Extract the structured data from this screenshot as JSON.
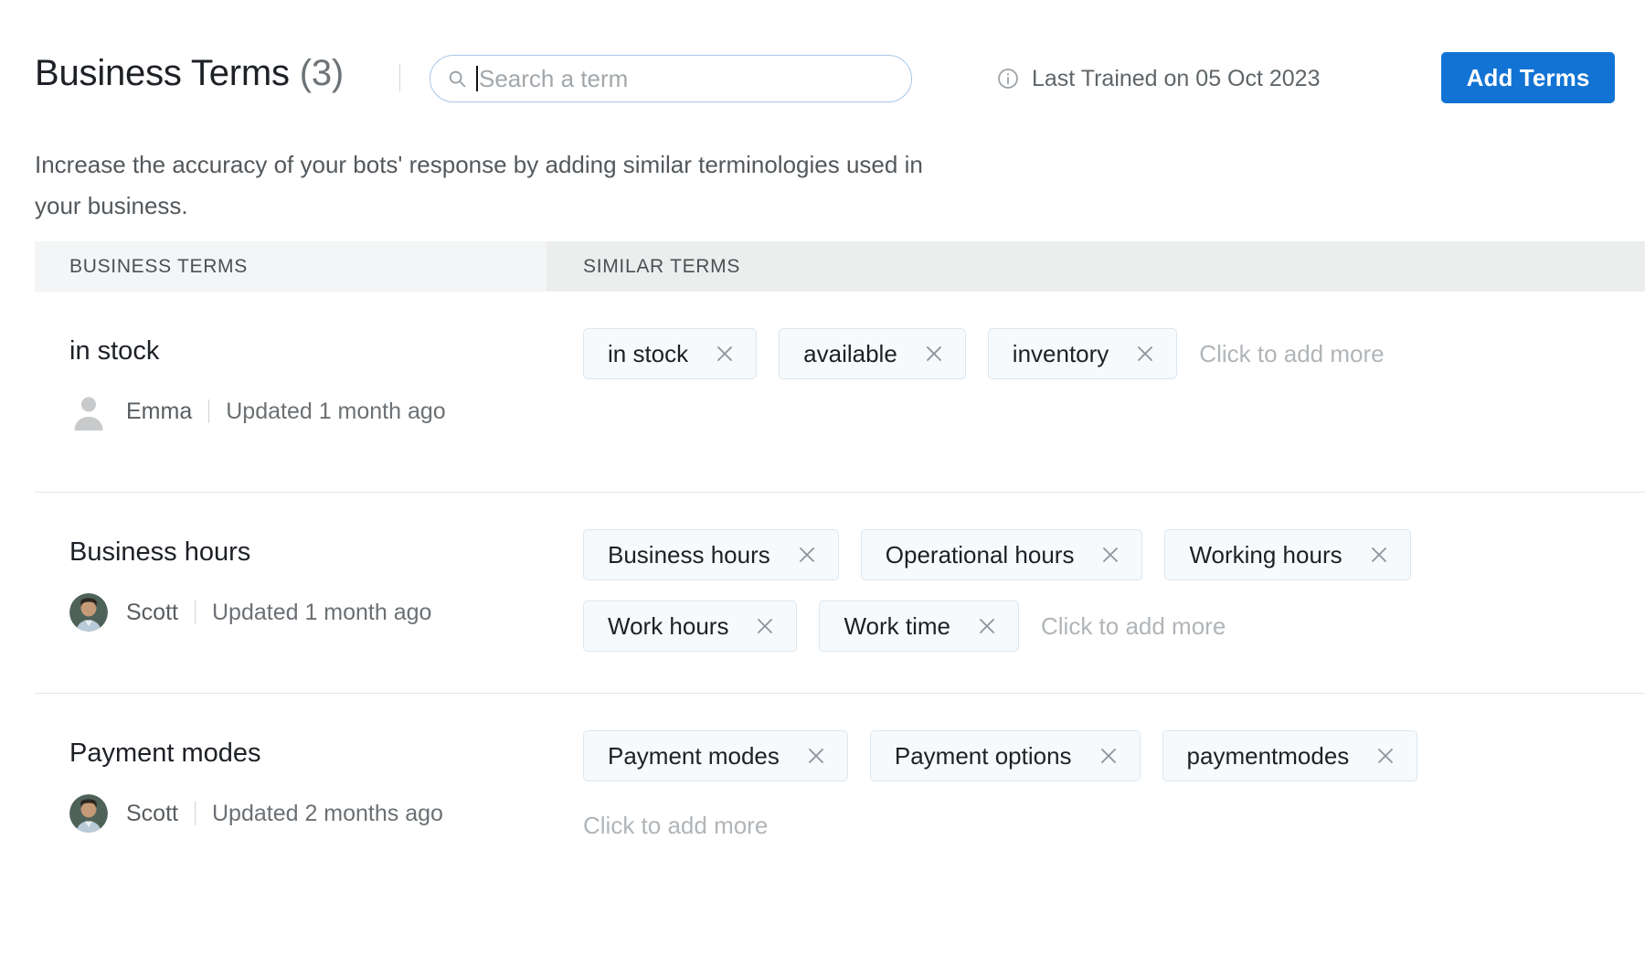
{
  "header": {
    "title": "Business Terms",
    "count": "(3)",
    "search": {
      "placeholder": "Search a term",
      "value": "",
      "icon": "search-icon"
    },
    "last_trained": "Last Trained on 05 Oct 2023",
    "info_icon": "info-circle-icon",
    "add_terms_label": "Add Terms",
    "accent_color": "#1273d4"
  },
  "subtitle": "Increase the accuracy of your bots' response by adding similar terminologies used in your business.",
  "table": {
    "columns": [
      "BUSINESS TERMS",
      "SIMILAR TERMS"
    ],
    "add_more_label": "Click to add more",
    "rows": [
      {
        "term": "in stock",
        "user": "Emma",
        "avatar_type": "placeholder",
        "updated": "Updated 1 month ago",
        "similar_terms": [
          "in stock",
          "available",
          "inventory"
        ],
        "add_more_on_own_line": false
      },
      {
        "term": "Business hours",
        "user": "Scott",
        "avatar_type": "photo",
        "updated": "Updated 1 month ago",
        "similar_terms": [
          "Business hours",
          "Operational hours",
          "Working hours",
          "Work hours",
          "Work time"
        ],
        "add_more_on_own_line": false
      },
      {
        "term": "Payment modes",
        "user": "Scott",
        "avatar_type": "photo",
        "updated": "Updated 2 months ago",
        "similar_terms": [
          "Payment modes",
          "Payment options",
          "paymentmodes"
        ],
        "add_more_on_own_line": true
      }
    ]
  }
}
